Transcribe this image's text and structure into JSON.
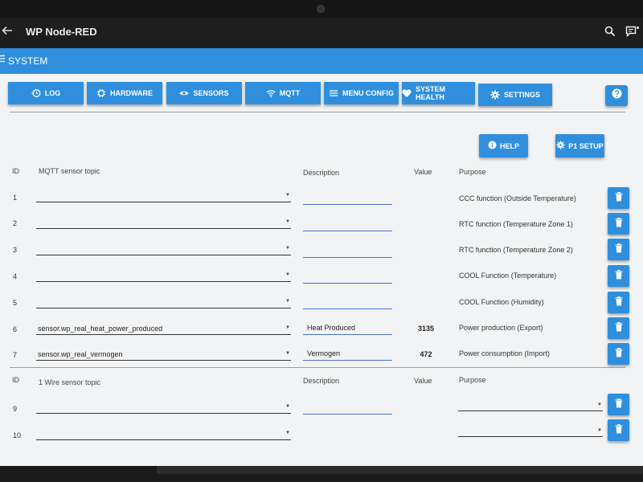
{
  "app": {
    "title": "WP Node-RED"
  },
  "header": {
    "title": "SYSTEM"
  },
  "tabs": [
    {
      "label": "LOG",
      "icon": "history-icon"
    },
    {
      "label": "HARDWARE",
      "icon": "chip-icon"
    },
    {
      "label": "SENSORS",
      "icon": "eye-icon"
    },
    {
      "label": "MQTT",
      "icon": "wifi-icon"
    },
    {
      "label": "MENU CONFIG",
      "icon": "menu-icon"
    },
    {
      "label": "SYSTEM HEALTH",
      "icon": "heart-icon"
    },
    {
      "label": "SETTINGS",
      "icon": "gear-icon"
    }
  ],
  "help_icon": "question-icon",
  "actions": {
    "help_label": "HELP",
    "p1_setup_label": "P1 SETUP"
  },
  "mqtt_section": {
    "headers": {
      "id": "ID",
      "topic": "MQTT sensor topic",
      "description": "Description",
      "value": "Value",
      "purpose": "Purpose"
    },
    "rows": [
      {
        "id": "1",
        "topic": "",
        "description": "",
        "value": "",
        "purpose": "CCC function (Outside Temperature)"
      },
      {
        "id": "2",
        "topic": "",
        "description": "",
        "value": "",
        "purpose": "RTC function (Temperature Zone 1)"
      },
      {
        "id": "3",
        "topic": "",
        "description": "",
        "value": "",
        "purpose": "RTC function (Temperature Zone 2)"
      },
      {
        "id": "4",
        "topic": "",
        "description": "",
        "value": "",
        "purpose": "COOL Function (Temperature)"
      },
      {
        "id": "5",
        "topic": "",
        "description": "",
        "value": "",
        "purpose": "COOL Function (Humidity)"
      },
      {
        "id": "6",
        "topic": "sensor.wp_real_heat_power_produced",
        "description": "Heat Produced",
        "value": "3135",
        "purpose": "Power production (Export)"
      },
      {
        "id": "7",
        "topic": "sensor.wp_real_vermogen",
        "description": "Vermogen",
        "value": "472",
        "purpose": "Power consumption (Import)"
      }
    ]
  },
  "wire_section": {
    "headers": {
      "id": "ID",
      "topic": "1 Wire sensor topic",
      "description": "Description",
      "value": "Value",
      "purpose": "Purpose"
    },
    "rows": [
      {
        "id": "9",
        "topic": "",
        "description": "",
        "value": "",
        "purpose": ""
      },
      {
        "id": "10",
        "topic": "",
        "description": "",
        "value": "",
        "purpose": ""
      }
    ]
  },
  "colors": {
    "primary": "#2f8fdc",
    "background": "#f2f3f4",
    "appbar": "#1e1e1e"
  }
}
